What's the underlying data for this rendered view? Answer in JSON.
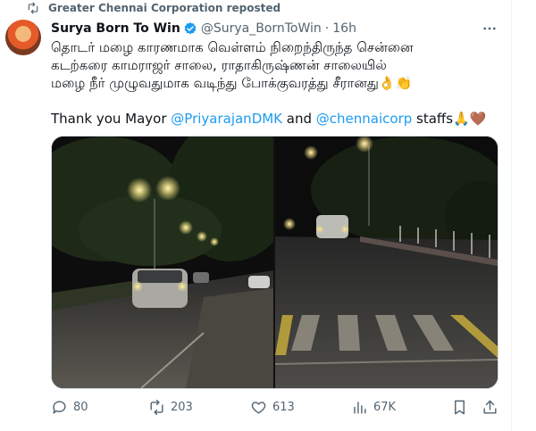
{
  "repost": {
    "label": "Greater Chennai Corporation reposted",
    "icon": "repost-icon"
  },
  "author": {
    "name": "Surya Born To Win",
    "handle": "@Surya_BornToWin",
    "separator": "·",
    "time": "16h",
    "verified_color": "#1d9bf0"
  },
  "tweet": {
    "line1": "தொடர் மழை காரணமாக வெள்ளம் நிறைந்திருந்த சென்னை",
    "line2": "கடற்கரை காமராஜர் சாலை, ராதாகிருஷ்ணன் சாலையில்",
    "line3": "மழை நீர் முழுவதுமாக வடிந்து போக்குவரத்து சீரானது👌👏",
    "thanks_prefix": "Thank you Mayor ",
    "mention1": "@PriyarajanDMK",
    "and": " and ",
    "mention2": "@chennaicorp",
    "thanks_suffix": " staffs🙏🤎"
  },
  "stats": {
    "replies": "80",
    "reposts": "203",
    "likes": "613",
    "views": "67K"
  },
  "colors": {
    "text": "#0f1419",
    "muted": "#536471",
    "link": "#1d9bf0",
    "border": "#cfd9de"
  }
}
